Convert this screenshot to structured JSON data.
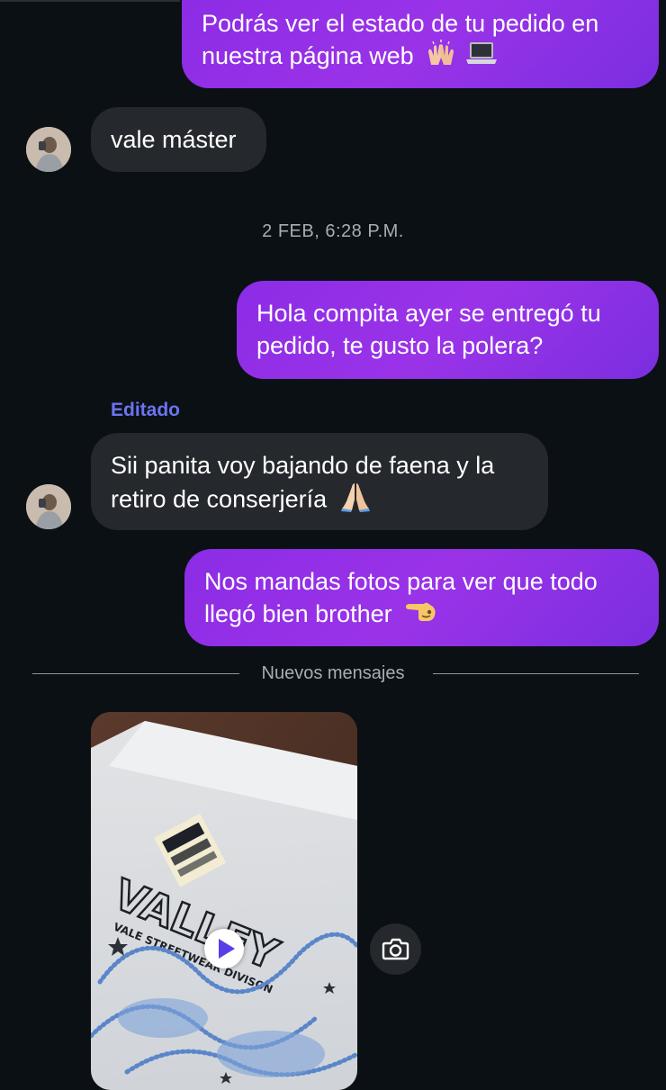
{
  "messages": [
    {
      "id": "m1",
      "direction": "outgoing",
      "text": "Podrás ver el estado de tu pedido en nuestra página web",
      "emojis": [
        "raising-hands-icon",
        "laptop-icon"
      ]
    },
    {
      "id": "m2",
      "direction": "incoming",
      "text": "vale máster"
    },
    {
      "id": "m3",
      "direction": "outgoing",
      "text": "Hola compita ayer se entregó tu pedido, te gusto la polera?"
    },
    {
      "id": "m4",
      "direction": "incoming",
      "edited_label": "Editado",
      "text": "Sii panita voy bajando de faena y la retiro de conserjería",
      "emojis": [
        "folded-hands-icon"
      ]
    },
    {
      "id": "m5",
      "direction": "outgoing",
      "text": "Nos mandas fotos para ver que todo llegó bien brother",
      "emojis": [
        "pointing-hand-icon"
      ]
    },
    {
      "id": "m6",
      "direction": "incoming",
      "type": "video"
    }
  ],
  "timestamp": "2 FEB, 6:28 P.M.",
  "divider": "Nuevos mensajes",
  "icons": {
    "play": "play-icon",
    "camera": "camera-icon"
  },
  "colors": {
    "background": "#0b1014",
    "outgoing_bubble": "#8c2ce6",
    "incoming_bubble": "#25282c",
    "edited_label": "#6b74f0",
    "play_icon": "#5b3de8"
  }
}
